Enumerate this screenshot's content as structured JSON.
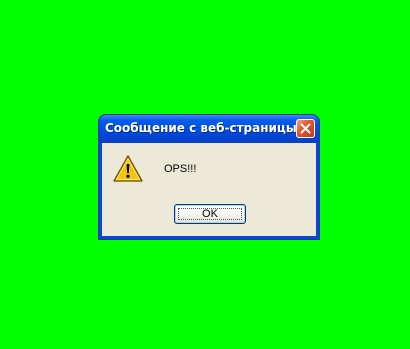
{
  "dialog": {
    "title": "Сообщение с веб-страницы",
    "message": "OPS!!!",
    "ok_label": "OK",
    "icon": "warning-icon",
    "close_icon": "close-icon"
  },
  "colors": {
    "background": "#00ff00",
    "titlebar": "#0051e1",
    "client": "#ece9d8",
    "close_button": "#e4582f"
  }
}
